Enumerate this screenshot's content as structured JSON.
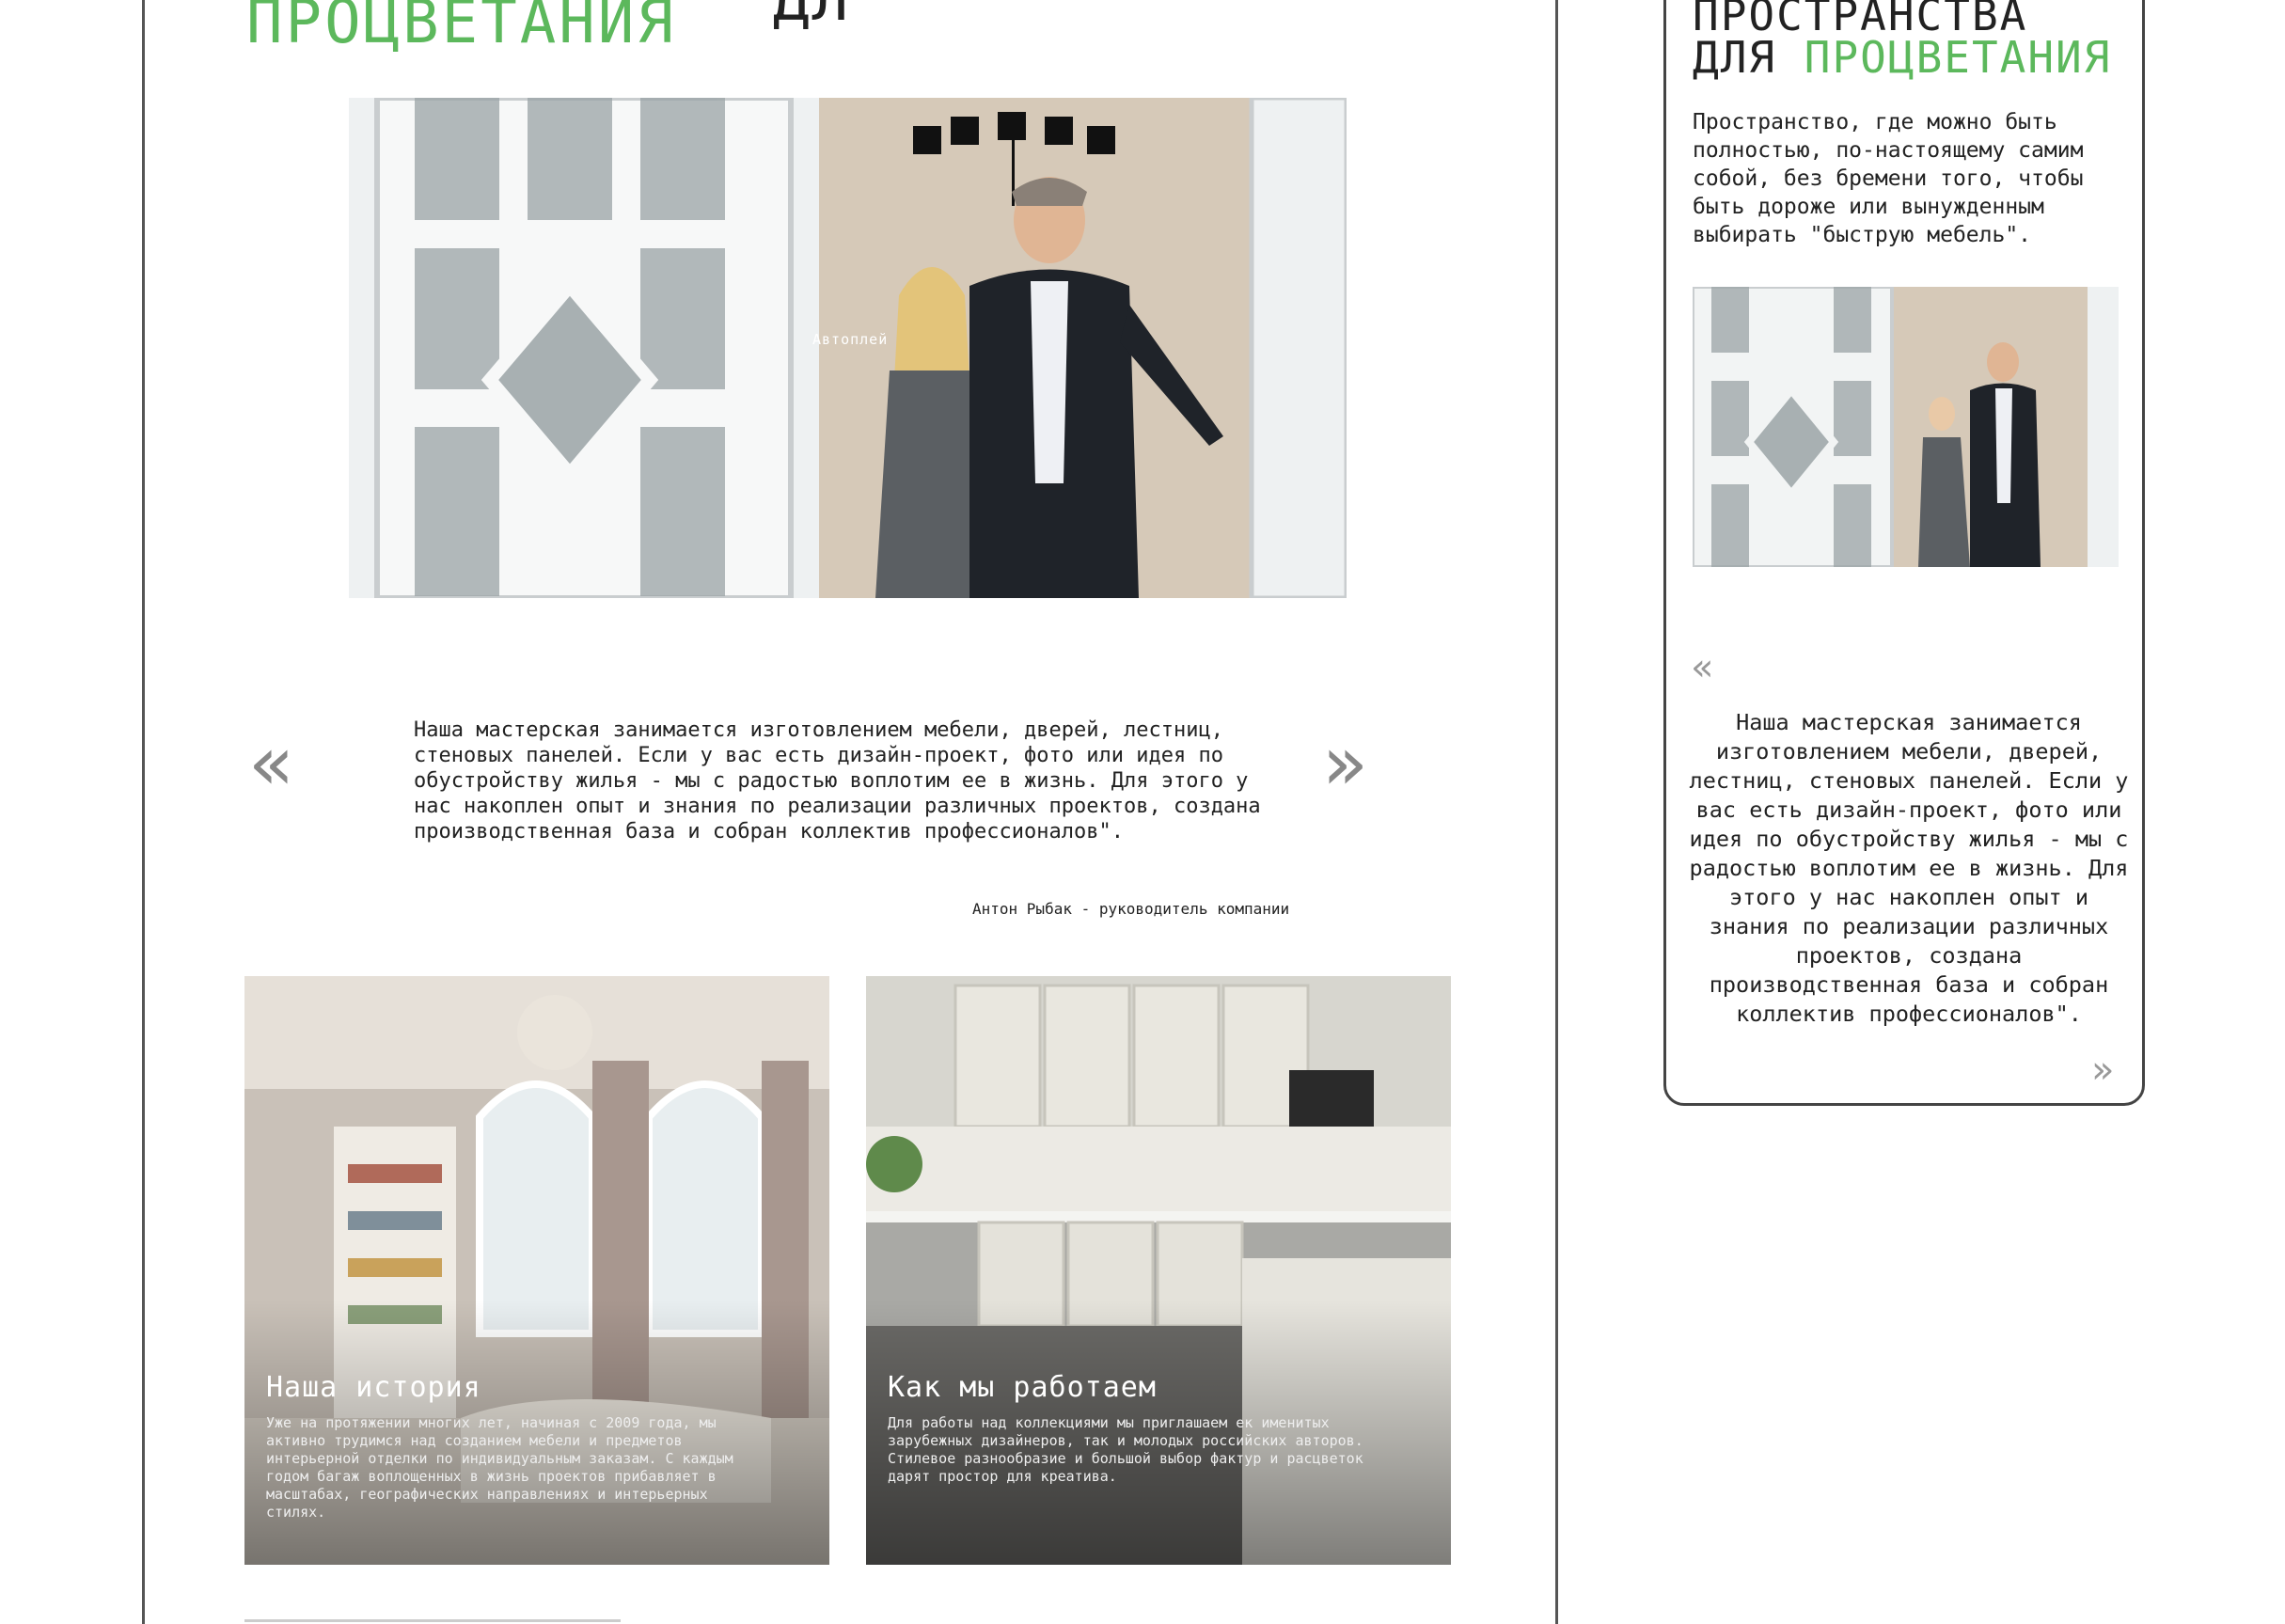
{
  "main": {
    "title_cut": "ДЛ",
    "title_green": "ПРОЦВЕТАНИЯ",
    "video_overlay": "Автоплей",
    "quote": "Наша мастерская занимается изготовлением мебели, дверей, лестниц, стеновых панелей. Если у вас есть дизайн-проект, фото или идея по обустройству жилья - мы с радостью воплотим ее в жизнь. Для этого у нас накоплен опыт  и знания по реализации различных проектов, создана производственная база и собран коллектив профессионалов\".",
    "prev_arrow": "«",
    "next_arrow": "»",
    "author": "Антон Рыбак - руководитель компании",
    "cards": [
      {
        "title": "Наша история",
        "text": "Уже на протяжении многих лет, начиная с 2009 года, мы активно трудимся над созданием мебели и предметов интерьерной отделки по индивидуальным заказам. С каждым годом багаж воплощенных в жизнь проектов прибавляет в масштабах, географических направлениях и интерьерных стилях."
      },
      {
        "title": "Как мы работаем",
        "text": "Для работы над коллекциями мы приглашаем ек именитых зарубежных дизайнеров, так и молодых российских авторов. Стилевое разнообразие и большой выбор фактур и расцветок дарят простор для креатива."
      }
    ]
  },
  "side": {
    "title_line1": "ПРОСТРАНСТВА",
    "title_line2_dark": "ДЛЯ",
    "title_line2_green": "ПРОЦВЕТАНИЯ",
    "description": "Пространство, где можно быть полностью, по-настоящему самим собой, без бремени того, чтобы быть дороже или вынужденным выбирать \"быструю мебель\".",
    "prev_arrow": "«",
    "next_arrow": "»",
    "quote": "Наша мастерская занимается изготовлением мебели, дверей, лестниц, стеновых панелей. Если у вас есть дизайн-проект, фото или идея по обустройству жилья - мы с радостью воплотим ее в жизнь. Для этого у нас накоплен опыт  и знания по реализации различных проектов, создана производственная база и собран коллектив профессионалов\"."
  },
  "colors": {
    "accent_green": "#5cb85c",
    "border": "#444444"
  }
}
